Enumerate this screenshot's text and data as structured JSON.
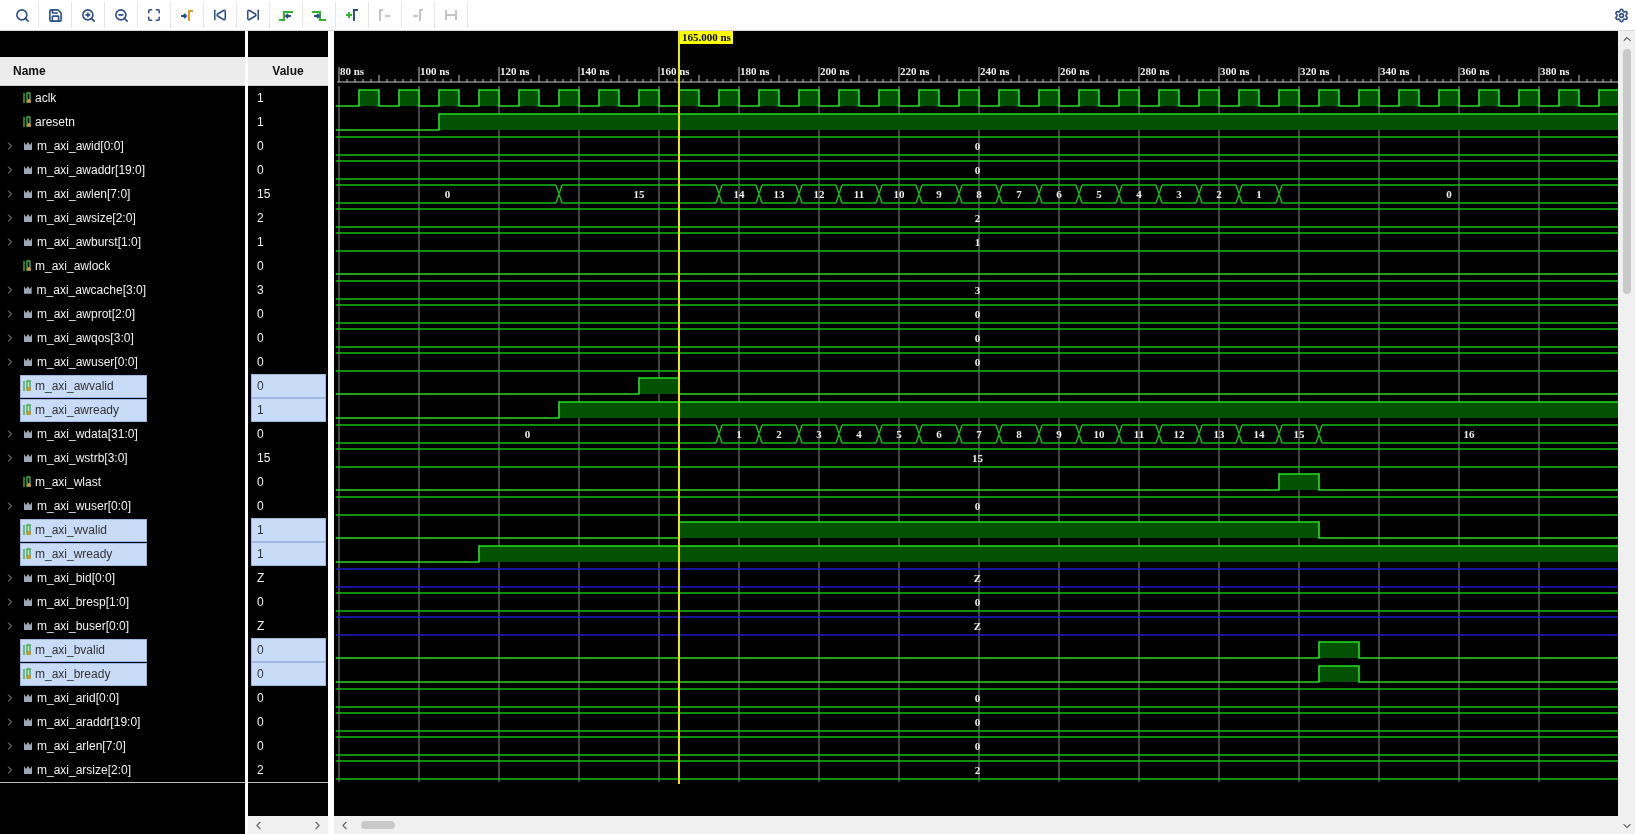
{
  "toolbar": {
    "buttons": [
      {
        "disabled": false
      },
      {
        "disabled": false
      },
      {
        "disabled": false
      },
      {
        "disabled": false
      },
      {
        "disabled": false
      },
      {
        "disabled": false
      },
      {
        "disabled": false
      },
      {
        "disabled": false
      },
      {
        "disabled": false
      },
      {
        "disabled": false
      },
      {
        "disabled": false
      },
      {
        "disabled": true
      },
      {
        "disabled": true
      },
      {
        "disabled": true
      }
    ]
  },
  "columns": {
    "name": "Name",
    "value": "Value"
  },
  "cursor": {
    "label": "165.000 ns"
  },
  "ruler": {
    "ticks": [
      "80 ns",
      "100 ns",
      "120 ns",
      "140 ns",
      "160 ns",
      "180 ns",
      "200 ns",
      "220 ns",
      "240 ns",
      "260 ns",
      "280 ns",
      "300 ns",
      "320 ns",
      "340 ns",
      "360 ns",
      "380 ns"
    ]
  },
  "signals": [
    {
      "name": "aclk",
      "value": "1",
      "kind": "bit",
      "selected": false
    },
    {
      "name": "aresetn",
      "value": "1",
      "kind": "bit",
      "selected": false
    },
    {
      "name": "m_axi_awid[0:0]",
      "value": "0",
      "kind": "bus",
      "selected": false,
      "segments": [
        "0"
      ]
    },
    {
      "name": "m_axi_awaddr[19:0]",
      "value": "0",
      "kind": "bus",
      "selected": false,
      "segments": [
        "0"
      ]
    },
    {
      "name": "m_axi_awlen[7:0]",
      "value": "15",
      "kind": "bus",
      "selected": false,
      "segments": [
        "0",
        "15",
        "14",
        "13",
        "12",
        "11",
        "10",
        "9",
        "8",
        "7",
        "6",
        "5",
        "4",
        "3",
        "2",
        "1",
        "0"
      ]
    },
    {
      "name": "m_axi_awsize[2:0]",
      "value": "2",
      "kind": "bus",
      "selected": false,
      "segments": [
        "2"
      ]
    },
    {
      "name": "m_axi_awburst[1:0]",
      "value": "1",
      "kind": "bus",
      "selected": false,
      "segments": [
        "1"
      ]
    },
    {
      "name": "m_axi_awlock",
      "value": "0",
      "kind": "bit",
      "selected": false
    },
    {
      "name": "m_axi_awcache[3:0]",
      "value": "3",
      "kind": "bus",
      "selected": false,
      "segments": [
        "3"
      ]
    },
    {
      "name": "m_axi_awprot[2:0]",
      "value": "0",
      "kind": "bus",
      "selected": false,
      "segments": [
        "0"
      ]
    },
    {
      "name": "m_axi_awqos[3:0]",
      "value": "0",
      "kind": "bus",
      "selected": false,
      "segments": [
        "0"
      ]
    },
    {
      "name": "m_axi_awuser[0:0]",
      "value": "0",
      "kind": "bus",
      "selected": false,
      "segments": [
        "0"
      ]
    },
    {
      "name": "m_axi_awvalid",
      "value": "0",
      "kind": "bit",
      "selected": true
    },
    {
      "name": "m_axi_awready",
      "value": "1",
      "kind": "bit",
      "selected": true
    },
    {
      "name": "m_axi_wdata[31:0]",
      "value": "0",
      "kind": "bus",
      "selected": false,
      "segments": [
        "0",
        "1",
        "2",
        "3",
        "4",
        "5",
        "6",
        "7",
        "8",
        "9",
        "10",
        "11",
        "12",
        "13",
        "14",
        "15",
        "16"
      ]
    },
    {
      "name": "m_axi_wstrb[3:0]",
      "value": "15",
      "kind": "bus",
      "selected": false,
      "segments": [
        "15"
      ]
    },
    {
      "name": "m_axi_wlast",
      "value": "0",
      "kind": "bit",
      "selected": false
    },
    {
      "name": "m_axi_wuser[0:0]",
      "value": "0",
      "kind": "bus",
      "selected": false,
      "segments": [
        "0"
      ]
    },
    {
      "name": "m_axi_wvalid",
      "value": "1",
      "kind": "bit",
      "selected": true
    },
    {
      "name": "m_axi_wready",
      "value": "1",
      "kind": "bit",
      "selected": true
    },
    {
      "name": "m_axi_bid[0:0]",
      "value": "Z",
      "kind": "highz",
      "selected": false,
      "segments": [
        "Z"
      ]
    },
    {
      "name": "m_axi_bresp[1:0]",
      "value": "0",
      "kind": "bus",
      "selected": false,
      "segments": [
        "0"
      ]
    },
    {
      "name": "m_axi_buser[0:0]",
      "value": "Z",
      "kind": "highz",
      "selected": false,
      "segments": [
        "Z"
      ]
    },
    {
      "name": "m_axi_bvalid",
      "value": "0",
      "kind": "bit",
      "selected": true
    },
    {
      "name": "m_axi_bready",
      "value": "0",
      "kind": "bit",
      "selected": true
    },
    {
      "name": "m_axi_arid[0:0]",
      "value": "0",
      "kind": "bus",
      "selected": false,
      "segments": [
        "0"
      ]
    },
    {
      "name": "m_axi_araddr[19:0]",
      "value": "0",
      "kind": "bus",
      "selected": false,
      "segments": [
        "0"
      ]
    },
    {
      "name": "m_axi_arlen[7:0]",
      "value": "0",
      "kind": "bus",
      "selected": false,
      "segments": [
        "0"
      ]
    },
    {
      "name": "m_axi_arsize[2:0]",
      "value": "2",
      "kind": "bus",
      "selected": false,
      "segments": [
        "2"
      ]
    }
  ]
}
